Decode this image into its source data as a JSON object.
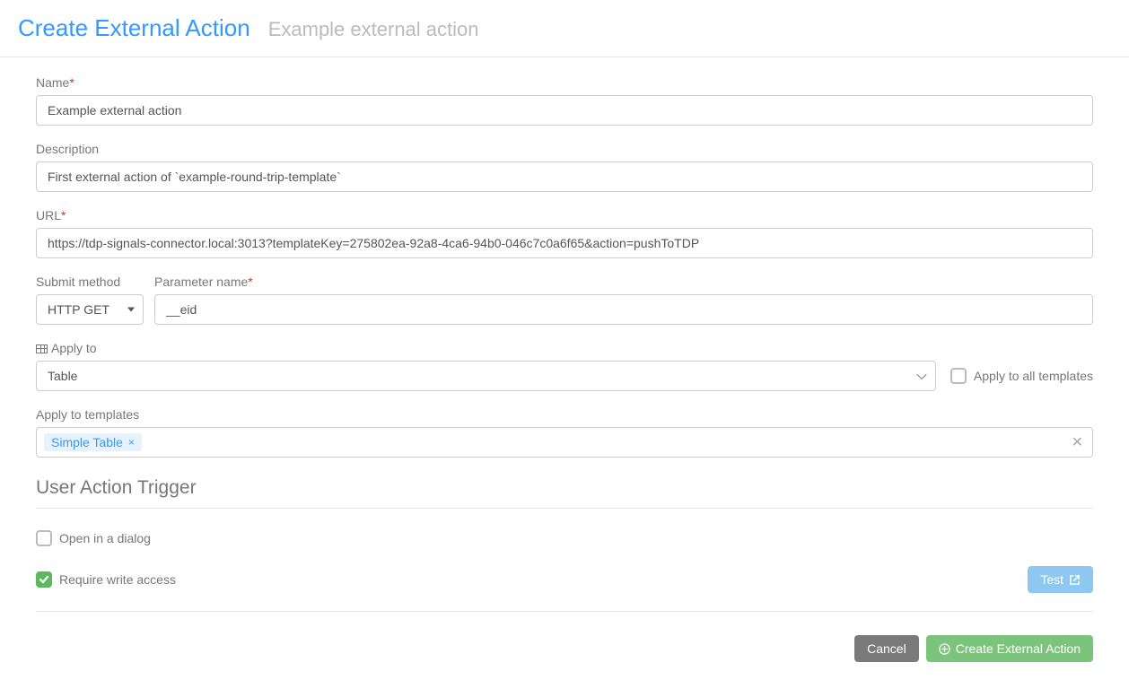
{
  "header": {
    "title": "Create External Action",
    "subtitle": "Example external action"
  },
  "form": {
    "name": {
      "label": "Name",
      "value": "Example external action"
    },
    "description": {
      "label": "Description",
      "value": "First external action of `example-round-trip-template`"
    },
    "url": {
      "label": "URL",
      "value": "https://tdp-signals-connector.local:3013?templateKey=275802ea-92a8-4ca6-94b0-046c7c0a6f65&action=pushToTDP"
    },
    "submitMethod": {
      "label": "Submit method",
      "value": "HTTP GET"
    },
    "parameterName": {
      "label": "Parameter name",
      "value": "__eid"
    },
    "applyTo": {
      "label": "Apply to",
      "value": "Table"
    },
    "applyAll": {
      "label": "Apply to all templates",
      "checked": false
    },
    "applyTemplates": {
      "label": "Apply to templates",
      "tags": [
        {
          "label": "Simple Table"
        }
      ]
    }
  },
  "trigger": {
    "title": "User Action Trigger",
    "openDialog": {
      "label": "Open in a dialog",
      "checked": false
    },
    "requireWrite": {
      "label": "Require write access",
      "checked": true
    },
    "testLabel": "Test"
  },
  "footer": {
    "cancel": "Cancel",
    "create": "Create External Action"
  }
}
